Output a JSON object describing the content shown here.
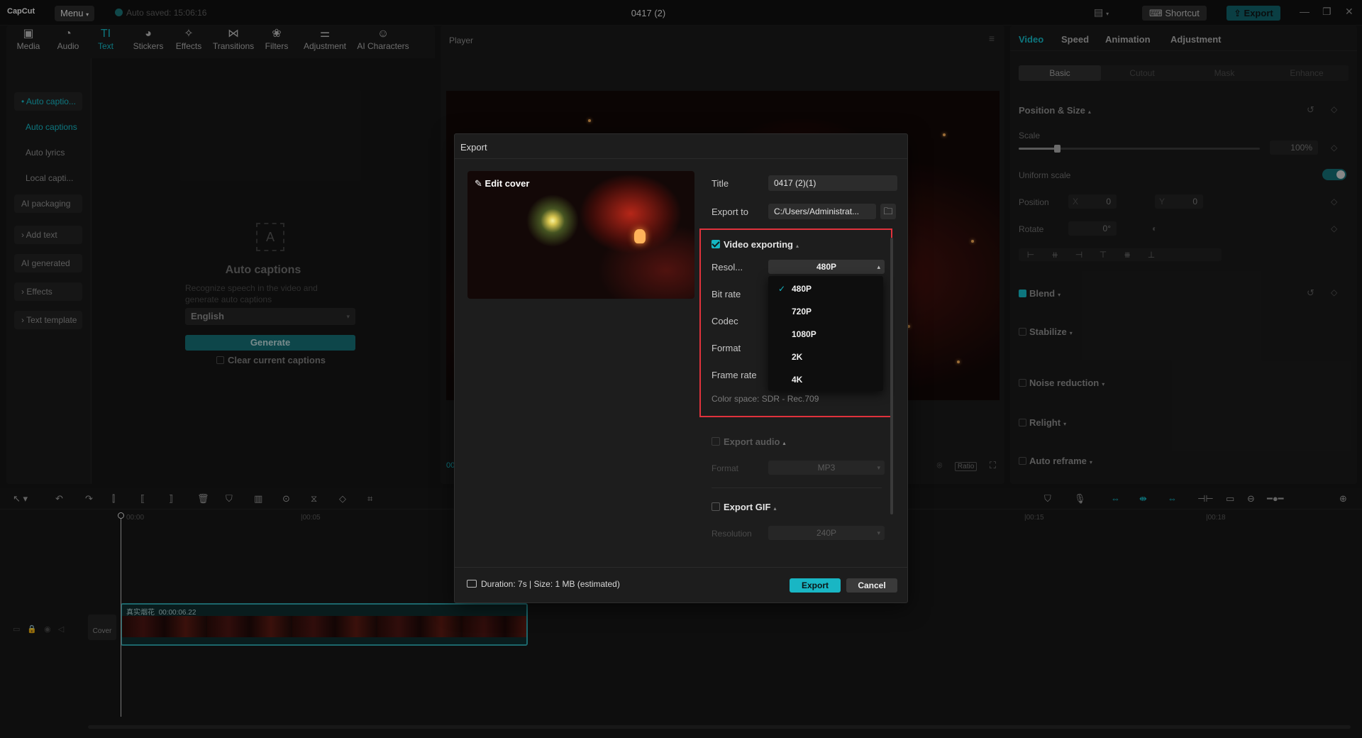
{
  "app": {
    "logo": "CapCut",
    "menu_label": "Menu",
    "autosave": "Auto saved: 15:06:16",
    "doc_title": "0417 (2)",
    "shortcut_label": "Shortcut",
    "export_label": "Export"
  },
  "toolbar": {
    "tabs": [
      {
        "label": "Media",
        "icon": "media-icon",
        "glyph": "▣"
      },
      {
        "label": "Audio",
        "icon": "audio-icon",
        "glyph": "◔"
      },
      {
        "label": "Text",
        "icon": "text-icon",
        "glyph": "TI"
      },
      {
        "label": "Stickers",
        "icon": "sticker-icon",
        "glyph": "◕"
      },
      {
        "label": "Effects",
        "icon": "effects-icon",
        "glyph": "✧"
      },
      {
        "label": "Transitions",
        "icon": "transitions-icon",
        "glyph": "⋈"
      },
      {
        "label": "Filters",
        "icon": "filters-icon",
        "glyph": "❀"
      },
      {
        "label": "Adjustment",
        "icon": "adjustment-icon",
        "glyph": "⚌"
      },
      {
        "label": "AI Characters",
        "icon": "ai-characters-icon",
        "glyph": "☺"
      }
    ],
    "active": "Text"
  },
  "left_nav": {
    "items": [
      {
        "label": "• Auto captio...",
        "kind": "group sel"
      },
      {
        "label": "Auto captions",
        "kind": "sub sel"
      },
      {
        "label": "Auto lyrics",
        "kind": "sub"
      },
      {
        "label": "Local capti...",
        "kind": "sub"
      },
      {
        "label": "AI packaging",
        "kind": "group"
      },
      {
        "label": "› Add text",
        "kind": "group"
      },
      {
        "label": "AI generated",
        "kind": "group"
      },
      {
        "label": "› Effects",
        "kind": "group"
      },
      {
        "label": "› Text template",
        "kind": "group"
      }
    ]
  },
  "captions": {
    "title": "Auto captions",
    "description": "Recognize speech in the video and generate auto captions",
    "language": "English",
    "generate_label": "Generate",
    "clear_label": "Clear current captions"
  },
  "player": {
    "title": "Player",
    "timecode": "00",
    "ratio_label": "Ratio"
  },
  "right_panel": {
    "tabs": [
      "Video",
      "Speed",
      "Animation",
      "Adjustment"
    ],
    "subtabs": [
      "Basic",
      "Cutout",
      "Mask",
      "Enhance"
    ],
    "position_size": "Position & Size",
    "scale_label": "Scale",
    "scale_value": "100%",
    "scale_fraction": 0.16,
    "uniform_scale": "Uniform scale",
    "position_label": "Position",
    "x_label": "X",
    "x_value": "0",
    "y_label": "Y",
    "y_value": "0",
    "rotate_label": "Rotate",
    "rotate_value": "0°",
    "blend": "Blend",
    "stabilize": "Stabilize",
    "noise_reduction": "Noise reduction",
    "relight": "Relight",
    "auto_reframe": "Auto reframe"
  },
  "timeline": {
    "ruler": [
      "00:00",
      "|00:05",
      "|00:15",
      "|00:18"
    ],
    "cover_label": "Cover",
    "clip_name": "真实烟花",
    "clip_duration": "00:00:06.22"
  },
  "export_dialog": {
    "title": "Export",
    "edit_cover": "Edit cover",
    "title_label": "Title",
    "title_value": "0417 (2)(1)",
    "export_to_label": "Export to",
    "export_to_value": "C:/Users/Administrat...",
    "video_exporting": "Video exporting",
    "resolution_label": "Resol...",
    "resolution_value": "480P",
    "bitrate_label": "Bit rate",
    "codec_label": "Codec",
    "format_label": "Format",
    "framerate_label": "Frame rate",
    "resolution_options": [
      "480P",
      "720P",
      "1080P",
      "2K",
      "4K"
    ],
    "color_space": "Color space: SDR - Rec.709",
    "export_audio": "Export audio",
    "audio_format_label": "Format",
    "audio_format_value": "MP3",
    "export_gif": "Export GIF",
    "gif_resolution_label": "Resolution",
    "gif_resolution_value": "240P",
    "duration_text": "Duration: 7s | Size: 1 MB (estimated)",
    "export_button": "Export",
    "cancel_button": "Cancel"
  },
  "colors": {
    "accent": "#15b5c2",
    "highlight_border": "#e0323c",
    "background": "#141414"
  }
}
